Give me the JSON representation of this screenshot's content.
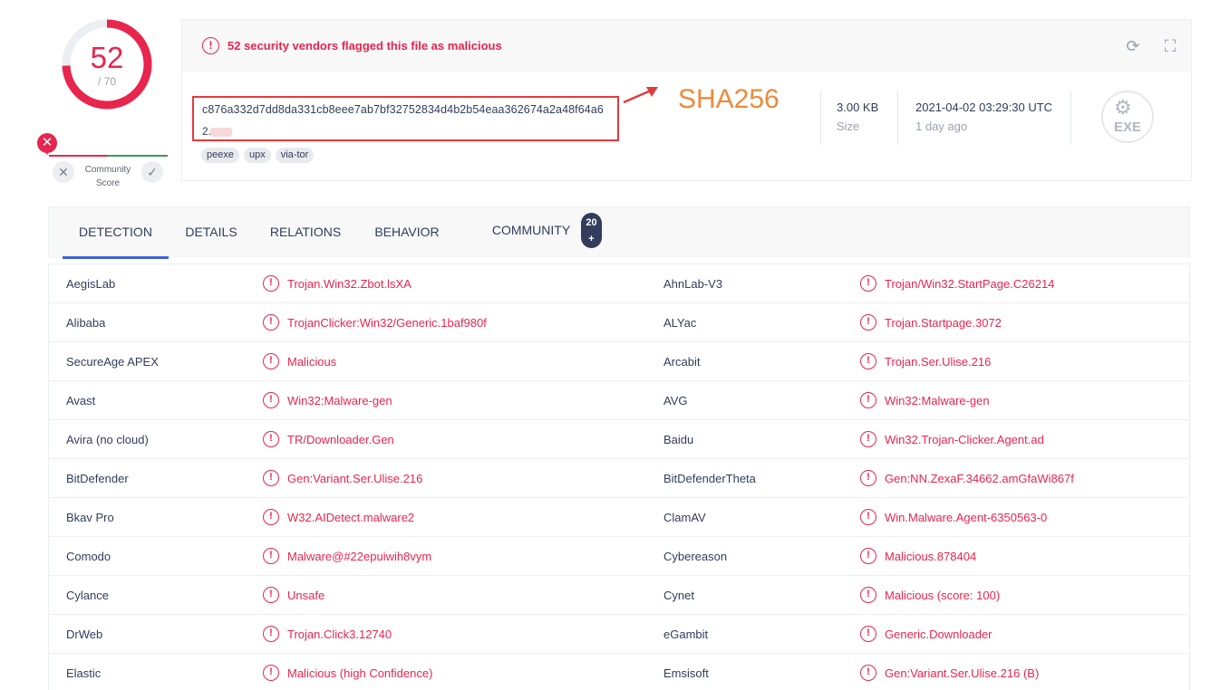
{
  "score": {
    "detections": "52",
    "total": "/ 70",
    "fraction": 0.743
  },
  "community": {
    "marker": "✕",
    "label_line1": "Community",
    "label_line2": "Score",
    "down_icon": "✕",
    "up_icon": "✓"
  },
  "alert": {
    "icon": "!",
    "text": "52 security vendors flagged this file as malicious"
  },
  "toolbar": {
    "reanalyze_icon": "⟳",
    "similar_icon": "⛶"
  },
  "file": {
    "hash_line1": "c876a332d7dd8da331cb8eee7ab7bf32752834d4b2b54eaa362674a2a48f64a6",
    "hash_line2": "2.",
    "tags": [
      "peexe",
      "upx",
      "via-tor"
    ],
    "annotation": "SHA256",
    "size": "3.00 KB",
    "size_label": "Size",
    "date": "2021-04-02 03:29:30 UTC",
    "date_relative": "1 day ago",
    "type_label": "EXE",
    "type_icon": "⚙"
  },
  "tabs": [
    {
      "label": "DETECTION"
    },
    {
      "label": "DETAILS"
    },
    {
      "label": "RELATIONS"
    },
    {
      "label": "BEHAVIOR"
    },
    {
      "label": "COMMUNITY"
    }
  ],
  "community_badge": {
    "line1": "20",
    "line2": "+"
  },
  "detections": [
    {
      "vendor1": "AegisLab",
      "result1": "Trojan.Win32.Zbot.lsXA",
      "vendor2": "AhnLab-V3",
      "result2": "Trojan/Win32.StartPage.C26214"
    },
    {
      "vendor1": "Alibaba",
      "result1": "TrojanClicker:Win32/Generic.1baf980f",
      "vendor2": "ALYac",
      "result2": "Trojan.Startpage.3072"
    },
    {
      "vendor1": "SecureAge APEX",
      "result1": "Malicious",
      "vendor2": "Arcabit",
      "result2": "Trojan.Ser.Ulise.216"
    },
    {
      "vendor1": "Avast",
      "result1": "Win32:Malware-gen",
      "vendor2": "AVG",
      "result2": "Win32:Malware-gen"
    },
    {
      "vendor1": "Avira (no cloud)",
      "result1": "TR/Downloader.Gen",
      "vendor2": "Baidu",
      "result2": "Win32.Trojan-Clicker.Agent.ad"
    },
    {
      "vendor1": "BitDefender",
      "result1": "Gen:Variant.Ser.Ulise.216",
      "vendor2": "BitDefenderTheta",
      "result2": "Gen:NN.ZexaF.34662.amGfaWi867f"
    },
    {
      "vendor1": "Bkav Pro",
      "result1": "W32.AIDetect.malware2",
      "vendor2": "ClamAV",
      "result2": "Win.Malware.Agent-6350563-0"
    },
    {
      "vendor1": "Comodo",
      "result1": "Malware@#22epuiwih8vym",
      "vendor2": "Cybereason",
      "result2": "Malicious.878404"
    },
    {
      "vendor1": "Cylance",
      "result1": "Unsafe",
      "vendor2": "Cynet",
      "result2": "Malicious (score: 100)"
    },
    {
      "vendor1": "DrWeb",
      "result1": "Trojan.Click3.12740",
      "vendor2": "eGambit",
      "result2": "Generic.Downloader"
    },
    {
      "vendor1": "Elastic",
      "result1": "Malicious (high Confidence)",
      "vendor2": "Emsisoft",
      "result2": "Gen:Variant.Ser.Ulise.216 (B)"
    }
  ],
  "colors": {
    "malicious": "#e8254d",
    "annotation": "#ec8a3a",
    "active_tab": "#3c62e0",
    "text": "#313d5a"
  }
}
